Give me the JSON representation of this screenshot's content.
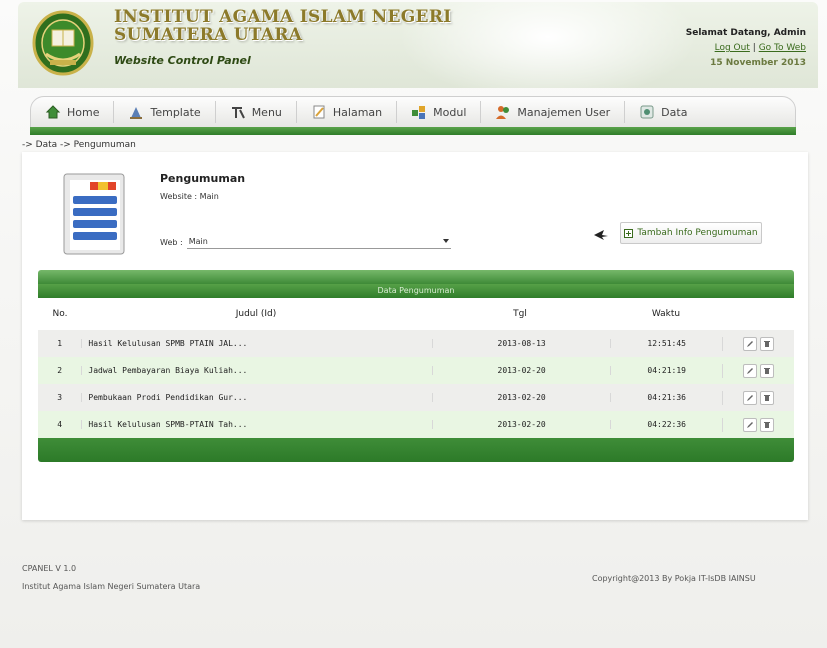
{
  "header": {
    "title_line1": "INSTITUT AGAMA ISLAM NEGERI",
    "title_line2": "SUMATERA UTARA",
    "subtitle": "Website Control Panel",
    "welcome": "Selamat Datang, Admin",
    "logout": "Log Out",
    "separator": "|",
    "go_to_web": "Go To Web",
    "date": "15 November 2013"
  },
  "nav": {
    "items": [
      {
        "label": "Home",
        "icon": "home-icon"
      },
      {
        "label": "Template",
        "icon": "template-icon"
      },
      {
        "label": "Menu",
        "icon": "menu-icon"
      },
      {
        "label": "Halaman",
        "icon": "page-icon"
      },
      {
        "label": "Modul",
        "icon": "module-icon"
      },
      {
        "label": "Manajemen User",
        "icon": "users-icon"
      },
      {
        "label": "Data",
        "icon": "data-icon"
      }
    ]
  },
  "breadcrumb": "-> Data -> Pengumuman",
  "page": {
    "title": "Pengumuman",
    "website_label": "Website : Main",
    "web_label": "Web :",
    "web_value": "Main",
    "add_button": "Tambah Info Pengumuman"
  },
  "table": {
    "caption": "Data Pengumuman",
    "headers": {
      "no": "No.",
      "judul": "Judul (Id)",
      "tgl": "Tgl",
      "waktu": "Waktu"
    },
    "rows": [
      {
        "no": "1",
        "judul": "Hasil Kelulusan SPMB PTAIN JAL...",
        "tgl": "2013-08-13",
        "waktu": "12:51:45"
      },
      {
        "no": "2",
        "judul": "Jadwal Pembayaran Biaya Kuliah...",
        "tgl": "2013-02-20",
        "waktu": "04:21:19"
      },
      {
        "no": "3",
        "judul": "Pembukaan Prodi Pendidikan Gur...",
        "tgl": "2013-02-20",
        "waktu": "04:21:36"
      },
      {
        "no": "4",
        "judul": "Hasil Kelulusan SPMB-PTAIN Tah...",
        "tgl": "2013-02-20",
        "waktu": "04:22:36"
      }
    ]
  },
  "footer": {
    "version": "CPANEL V 1.0",
    "institution": "Institut Agama Islam Negeri Sumatera Utara",
    "copyright": "Copyright@2013 By Pokja IT-IsDB IAINSU"
  },
  "colors": {
    "primary_green": "#2f7d2a",
    "light_green_row": "#e9f6e3",
    "title_gold": "#8c7a2a"
  }
}
